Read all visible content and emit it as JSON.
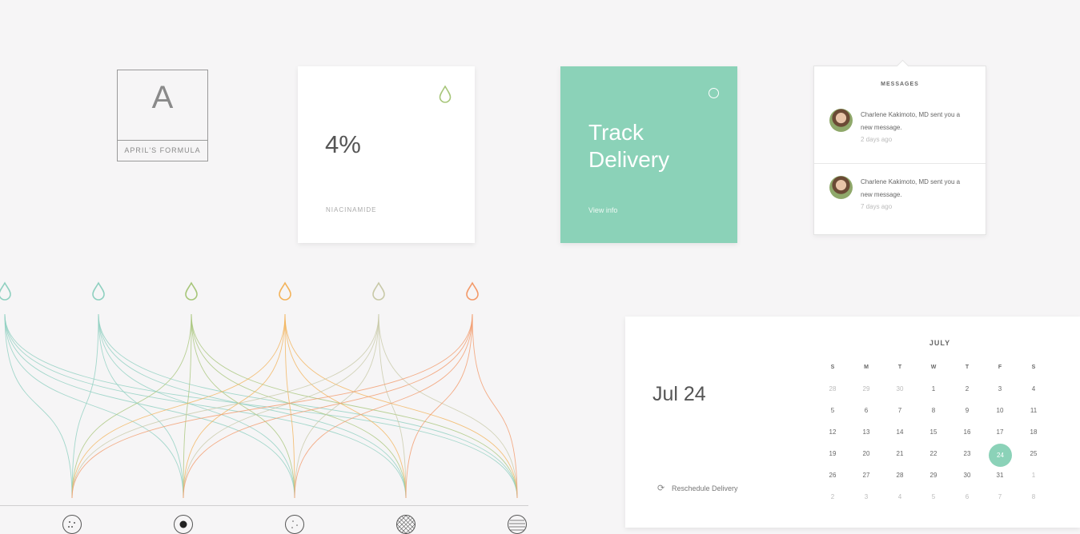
{
  "logo": {
    "letter": "A",
    "caption": "APRIL'S FORMULA"
  },
  "stat_card": {
    "value": "4%",
    "label": "NIACINAMIDE",
    "icon": "drop-icon",
    "icon_color": "#a7c67a"
  },
  "track_card": {
    "title": "Track Delivery",
    "link": "View info",
    "icon": "ring-icon",
    "bg_color": "#8bd2b8"
  },
  "messages": {
    "heading": "MESSAGES",
    "items": [
      {
        "text": "Charlene Kakimoto, MD sent you a new message.",
        "time": "2 days ago"
      },
      {
        "text": "Charlene Kakimoto, MD sent you a new message.",
        "time": "7 days ago"
      }
    ]
  },
  "calendar": {
    "date": "Jul 24",
    "reschedule": "Reschedule Delivery",
    "month": "JULY",
    "weekdays": [
      "S",
      "M",
      "T",
      "W",
      "T",
      "F",
      "S"
    ],
    "weeks": [
      [
        "28",
        "29",
        "30",
        "1",
        "2",
        "3",
        "4"
      ],
      [
        "5",
        "6",
        "7",
        "8",
        "9",
        "10",
        "11"
      ],
      [
        "12",
        "13",
        "14",
        "15",
        "16",
        "17",
        "18"
      ],
      [
        "19",
        "20",
        "21",
        "22",
        "23",
        "24",
        "25"
      ],
      [
        "26",
        "27",
        "28",
        "29",
        "30",
        "31",
        "1"
      ],
      [
        "2",
        "3",
        "4",
        "5",
        "6",
        "7",
        "8"
      ]
    ],
    "selected": "24",
    "accent": "#8bd2b8"
  },
  "network": {
    "drop_colors": [
      "#8fd0c0",
      "#8fd0c0",
      "#a7c67a",
      "#f3b35a",
      "#c8c9a8",
      "#f39a6a"
    ],
    "bottom_icons": [
      "dotted-circle-icon",
      "target-icon",
      "sparse-dot-icon",
      "crosshatch-icon",
      "striped-circle-icon"
    ]
  }
}
